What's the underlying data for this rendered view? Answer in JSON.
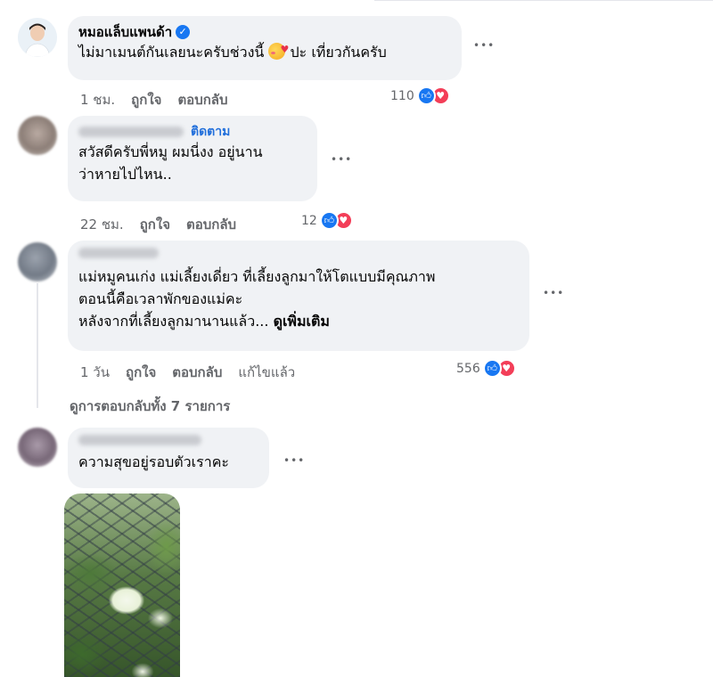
{
  "comments": [
    {
      "author": "หมอแล็บแพนด้า",
      "verified": true,
      "text_before_emoji": "ไม่มาเมนต์กันเลยนะครับช่วงนี้ ",
      "text_after_emoji": " ปะ เที่ยวกันครับ",
      "emoji": "smiling-face-with-hearts",
      "time": "1 ชม.",
      "like_label": "ถูกใจ",
      "reply_label": "ตอบกลับ",
      "reaction_count": "110"
    },
    {
      "follow_label": "ติดตาม",
      "text_line1": "สวัสดีครับพี่หมู ผมนี่งง อยู่นาน",
      "text_line2": "ว่าหายไปไหน..",
      "time": "22 ชม.",
      "like_label": "ถูกใจ",
      "reply_label": "ตอบกลับ",
      "reaction_count": "12"
    },
    {
      "text_line1": "แม่หมูคนเก่ง แม่เลี้ยงเดี่ยว ที่เลี้ยงลูกมาให้โตแบบมีคุณภาพ",
      "text_line2": "ตอนนี้คือเวลาพักของแม่คะ",
      "text_line3": "หลังจากที่เลี้ยงลูกมานานแล้ว...",
      "see_more": "ดูเพิ่มเติม",
      "time": "1 วัน",
      "like_label": "ถูกใจ",
      "reply_label": "ตอบกลับ",
      "edited_label": "แก้ไขแล้ว",
      "reaction_count": "556"
    },
    {
      "text": "ความสุขอยู่รอบตัวเราคะ"
    }
  ],
  "view_replies": "ดูการตอบกลับทั้ง 7 รายการ",
  "menu_dots": "•••",
  "icons": {
    "like": "thumbs-up-icon",
    "love": "heart-icon",
    "verified": "verified-badge-icon"
  },
  "colors": {
    "bubble": "#f0f2f5",
    "link": "#216fdb",
    "like": "#1877f2",
    "love": "#f33e58",
    "muted": "#65676b"
  }
}
